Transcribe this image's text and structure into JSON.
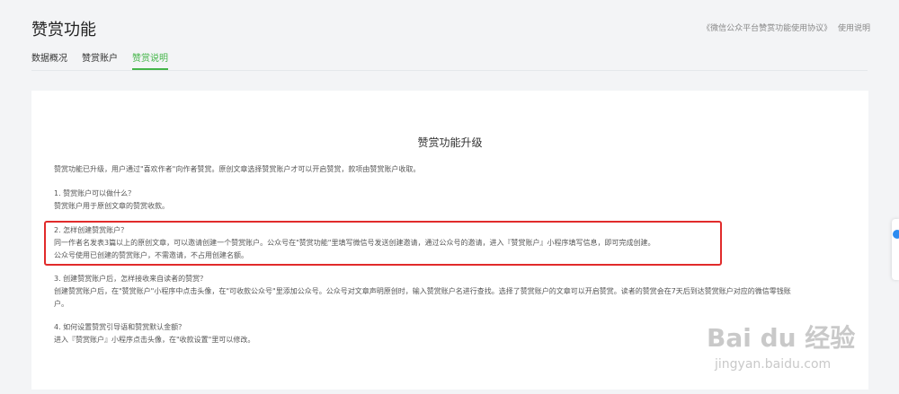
{
  "header": {
    "title": "赞赏功能",
    "agreement_link": "《微信公众平台赞赏功能使用协议》",
    "help_link": "使用说明"
  },
  "tabs": [
    {
      "label": "数据概况"
    },
    {
      "label": "赞赏账户"
    },
    {
      "label": "赞赏说明"
    }
  ],
  "content": {
    "title": "赞赏功能升级",
    "intro": "赞赏功能已升级，用户通过\"喜欢作者\"向作者赞赏。原创文章选择赞赏账户才可以开启赞赏，款项由赞赏账户收取。",
    "q1": "1. 赞赏账户可以做什么？",
    "a1": "赞赏账户用于原创文章的赞赏收款。",
    "q2": "2. 怎样创建赞赏账户？",
    "a2_line1": "同一作者名发表3篇以上的原创文章，可以邀请创建一个赞赏账户。公众号在\"赞赏功能\"里填写微信号发送创建邀请，通过公众号的邀请，进入『赞赏账户』小程序填写信息，即可完成创建。",
    "a2_line2": "公众号使用已创建的赞赏账户，不需邀请，不占用创建名额。",
    "q3": "3. 创建赞赏账户后，怎样接收来自读者的赞赏？",
    "a3_line1": "创建赞赏账户后，在\"赞赏账户\"小程序中点击头像，在\"可收款公众号\"里添加公众号。公众号对文章声明原创时，输入赞赏账户名进行查找。选择了赞赏账户的文章可以开启赞赏。读者的赞赏会在7天后到达赞赏账户对应的微信零钱账",
    "a3_line2": "户。",
    "q4": "4. 如何设置赞赏引导语和赞赏默认金额？",
    "a4": "进入『赞赏账户』小程序点击头像，在\"收款设置\"里可以修改。"
  },
  "watermark": {
    "brand": "Bai du 经验",
    "url": "jingyan.baidu.com"
  },
  "colors": {
    "accent": "#44b549",
    "highlight_border": "#e12b2b",
    "background": "#f3f4f6"
  }
}
